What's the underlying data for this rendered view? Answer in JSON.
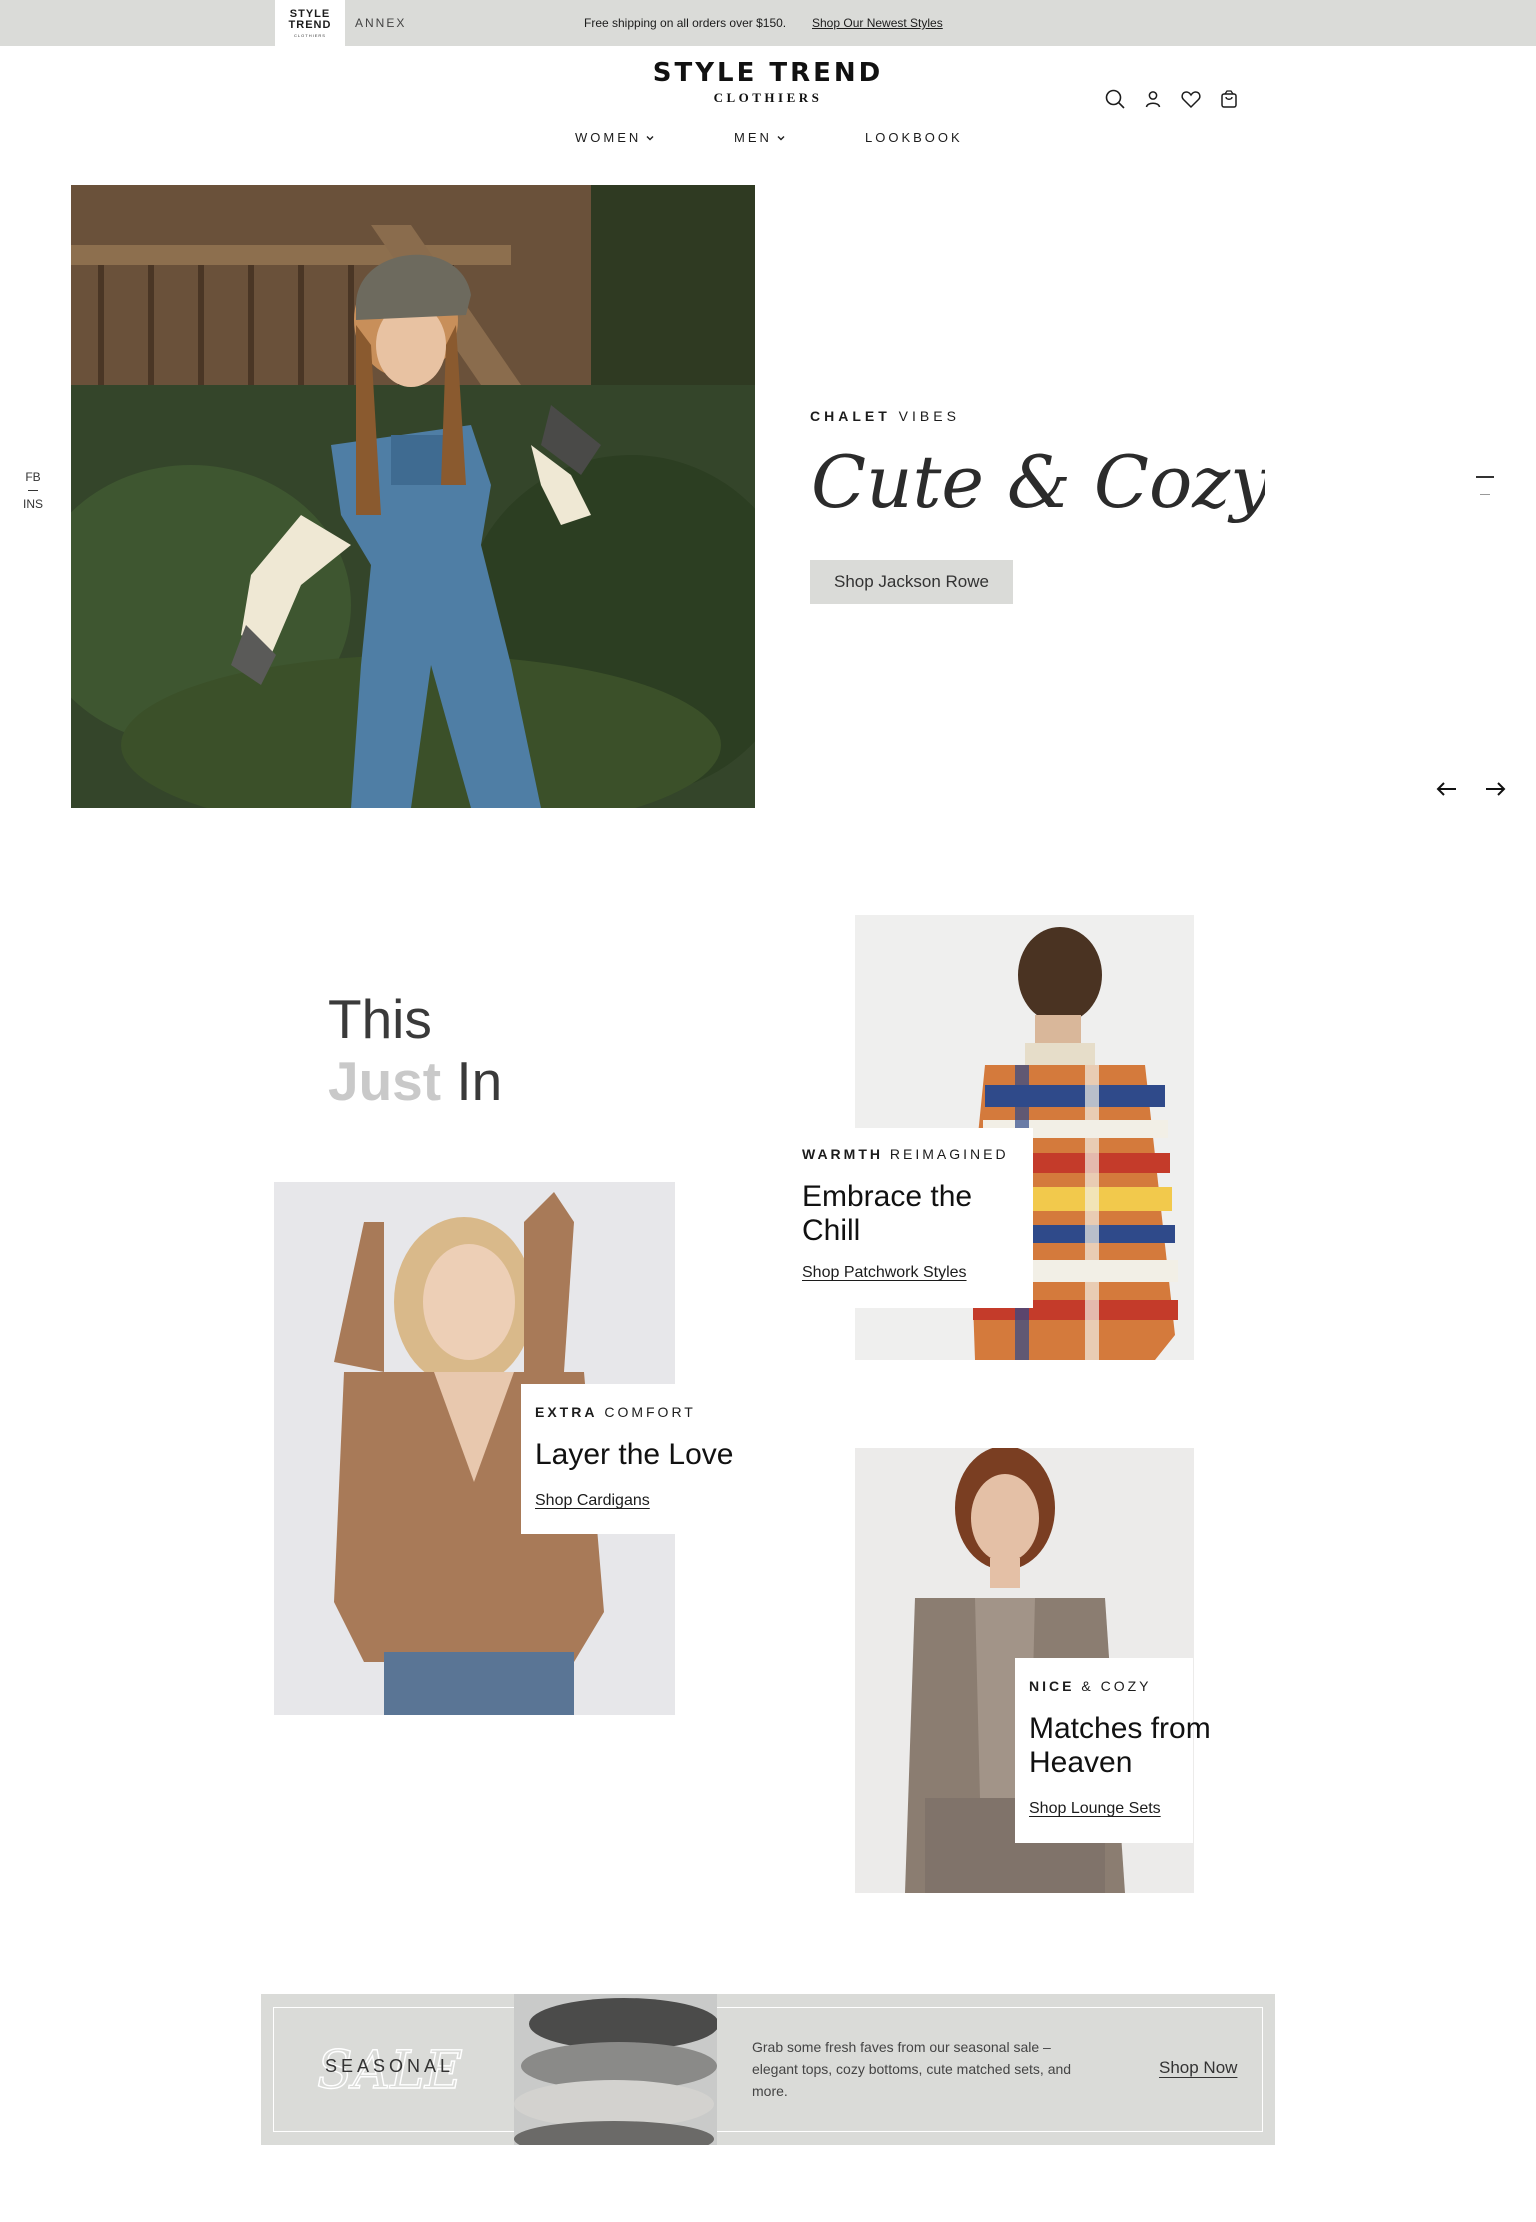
{
  "topbar": {
    "brand_line1": "STYLE",
    "brand_line2": "TREND",
    "brand_line3": "CLOTHIERS",
    "annex_label": "ANNEX",
    "promo_text": "Free shipping on all orders over $150.",
    "promo_link": "Shop Our Newest Styles"
  },
  "header": {
    "logo_main": "STYLE TREND",
    "logo_sub": "CLOTHIERS",
    "icons": [
      "search-icon",
      "account-icon",
      "wishlist-icon",
      "cart-icon"
    ]
  },
  "nav": {
    "items": [
      {
        "label": "WOMEN",
        "has_dropdown": true
      },
      {
        "label": "MEN",
        "has_dropdown": true
      },
      {
        "label": "LOOKBOOK",
        "has_dropdown": false
      }
    ]
  },
  "social": {
    "fb": "FB",
    "ins": "INS"
  },
  "hero": {
    "eyebrow_bold": "CHALET",
    "eyebrow_light": "VIBES",
    "script_title": "Cute & Cozy",
    "button_label": "Shop Jackson Rowe",
    "slide_index": 1,
    "slide_count": 2
  },
  "just_in": {
    "title_line1": "This",
    "title_muted": "Just",
    "title_line2_rest": "In"
  },
  "cards": [
    {
      "eyebrow_bold": "WARMTH",
      "eyebrow_light": "REIMAGINED",
      "title": "Embrace the Chill",
      "link": "Shop Patchwork Styles"
    },
    {
      "eyebrow_bold": "EXTRA",
      "eyebrow_light": "COMFORT",
      "title": "Layer the Love",
      "link": "Shop Cardigans"
    },
    {
      "eyebrow_bold": "NICE",
      "eyebrow_amp": "&",
      "eyebrow_light": "COZY",
      "title": "Matches from Heaven",
      "link": "Shop Lounge Sets"
    }
  ],
  "banner": {
    "script": "SALE",
    "label": "SEASONAL",
    "description": "Grab some fresh faves from our seasonal sale – elegant tops, cozy bottoms, cute matched sets, and more.",
    "link": "Shop Now"
  },
  "colors": {
    "topbar_bg": "#dadbd8",
    "button_bg": "#dadbd8",
    "text": "#1c1c1c",
    "muted_text": "#c9c9c9"
  }
}
